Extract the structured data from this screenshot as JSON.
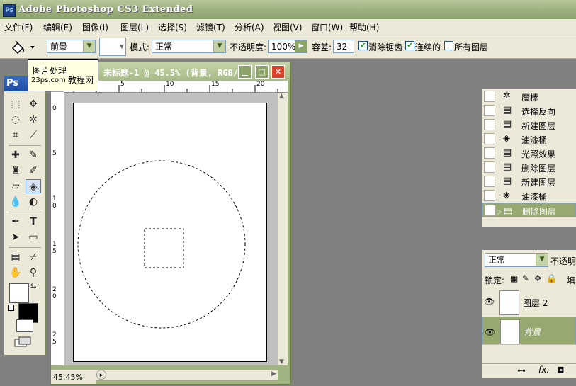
{
  "app": {
    "title": "Adobe Photoshop CS3 Extended",
    "logo": "Ps"
  },
  "menu": [
    "文件(F)",
    "编辑(E)",
    "图像(I)",
    "图层(L)",
    "选择(S)",
    "滤镜(T)",
    "分析(A)",
    "视图(V)",
    "窗口(W)",
    "帮助(H)"
  ],
  "options": {
    "fill_source": "前景",
    "mode_label": "模式:",
    "mode_value": "正常",
    "opacity_label": "不透明度:",
    "opacity_value": "100%",
    "tolerance_label": "容差:",
    "tolerance_value": "32",
    "antialias_label": "消除锯齿",
    "contiguous_label": "连续的",
    "all_layers_label": "所有图层"
  },
  "tooltip": {
    "line1": "图片处理",
    "site": "23ps.com",
    "brand": "教程网"
  },
  "toolbox": {
    "logo": "Ps"
  },
  "document": {
    "title": "未标题-1 @ 45.5% (背景, RGB/8)",
    "zoom": "45.45%",
    "ruler_top": [
      "0",
      "5",
      "10",
      "15",
      "20"
    ],
    "ruler_left": [
      "0",
      "5",
      "10",
      "15",
      "20",
      "25"
    ]
  },
  "history": {
    "items": [
      {
        "label": "魔棒",
        "icon": "magic-wand-icon"
      },
      {
        "label": "选择反向",
        "icon": "history-state-icon"
      },
      {
        "label": "新建图层",
        "icon": "history-state-icon"
      },
      {
        "label": "油漆桶",
        "icon": "paint-bucket-icon"
      },
      {
        "label": "光照效果",
        "icon": "history-state-icon"
      },
      {
        "label": "删除图层",
        "icon": "history-state-icon"
      },
      {
        "label": "新建图层",
        "icon": "history-state-icon"
      },
      {
        "label": "油漆桶",
        "icon": "paint-bucket-icon"
      },
      {
        "label": "删除图层",
        "icon": "history-state-icon"
      }
    ],
    "selected_index": 8
  },
  "layers": {
    "blend_mode": "正常",
    "opacity_label": "不透明",
    "lock_label": "锁定:",
    "fill_label": "填",
    "items": [
      {
        "name": "图层 2"
      },
      {
        "name": "背景"
      }
    ],
    "footer_fx": "fx."
  },
  "colors": {
    "accent": "#97a871",
    "title_bar": "#9cb07d",
    "panel_bg": "#ece9d8"
  }
}
